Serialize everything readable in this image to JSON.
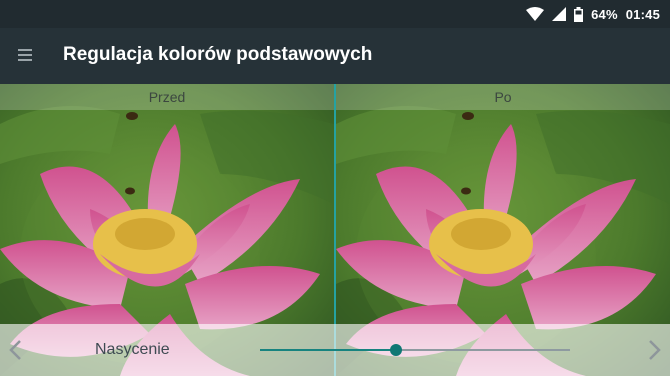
{
  "status_bar": {
    "battery_percent": "64%",
    "time": "01:45",
    "icons": [
      "wifi-icon",
      "signal-icon",
      "battery-icon"
    ]
  },
  "toolbar": {
    "title": "Regulacja kolorów podstawowych",
    "menu_icon": "menu-icon"
  },
  "preview": {
    "before_label": "Przed",
    "after_label": "Po"
  },
  "controls": {
    "setting_label": "Nasycenie",
    "slider_value_fraction": 0.44,
    "prev_icon": "chevron-left-icon",
    "next_icon": "chevron-right-icon"
  },
  "colors": {
    "accent": "#17837f",
    "divider": "#25a2a2",
    "toolbar": "#263238"
  }
}
